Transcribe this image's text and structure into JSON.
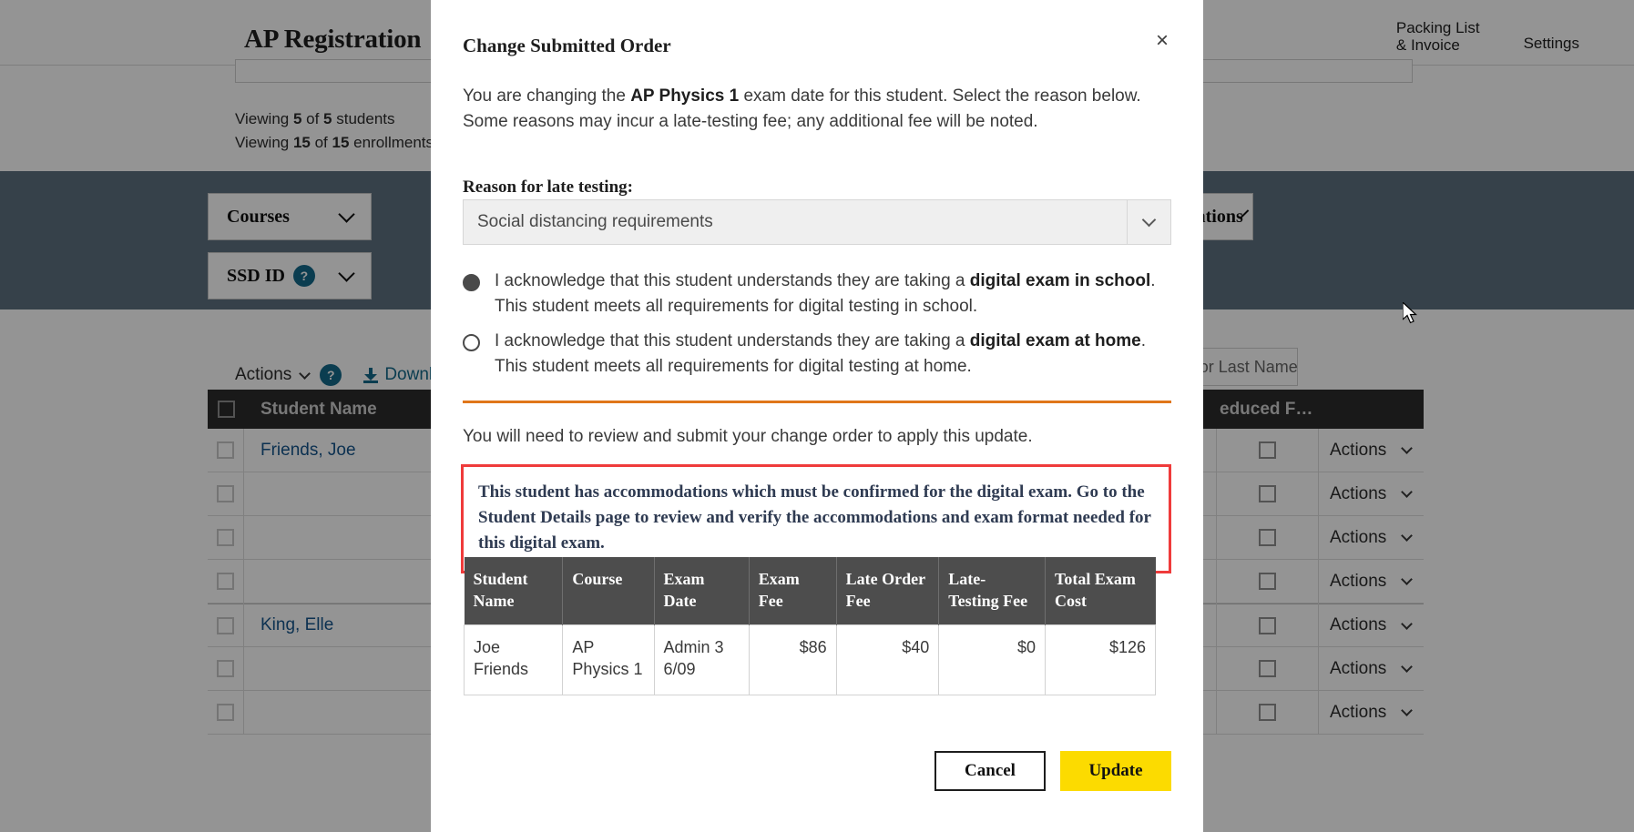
{
  "background": {
    "title": "AP Registration",
    "nav": [
      {
        "name": "packing-list-invoice",
        "line1": "Packing List",
        "line2": "& Invoice"
      },
      {
        "name": "settings",
        "line1": "Settings",
        "line2": ""
      }
    ],
    "viewing_students": "Viewing 5 of 5 students",
    "viewing_students_parts": {
      "prefix": "Viewing ",
      "count": "5",
      "mid": " of ",
      "total": "5",
      "suffix": " students"
    },
    "viewing_enrollments_parts": {
      "prefix": "Viewing ",
      "count": "15",
      "mid": " of ",
      "total": "15",
      "suffix": " enrollments"
    },
    "filters": [
      {
        "label": "Courses",
        "has_help": false
      },
      {
        "label": "SSD ID",
        "has_help": true
      },
      {
        "label": "Accommodations",
        "has_help": false
      }
    ],
    "actions_label": "Actions",
    "download_label": "Download",
    "search_placeholder": "Search by AP ID or Last Name",
    "table": {
      "headers": {
        "student_name": "Student Name",
        "reduced_fee": "educed F…",
        "actions": ""
      },
      "rows": [
        {
          "student": "Friends, Joe",
          "actions": "Actions",
          "group_start": true
        },
        {
          "student": "",
          "actions": "Actions",
          "group_start": false
        },
        {
          "student": "",
          "actions": "Actions",
          "group_start": false
        },
        {
          "student": "",
          "actions": "Actions",
          "group_start": false
        },
        {
          "student": "King, Elle",
          "actions": "Actions",
          "group_start": true
        },
        {
          "student": "",
          "actions": "Actions",
          "group_start": false
        },
        {
          "student": "",
          "actions": "Actions",
          "group_start": false
        }
      ]
    },
    "accent_filterbar": "#5d7080"
  },
  "modal": {
    "title": "Change Submitted Order",
    "close_label": "×",
    "intro": {
      "part1": "You are changing the ",
      "course": "AP Physics 1",
      "part2": " exam date for this student. Select the reason below. Some reasons may incur a late-testing fee; any additional fee will be noted."
    },
    "reason_label": "Reason for late testing:",
    "reason_selected": "Social distancing requirements",
    "radios": [
      {
        "name": "digital-exam-in-school",
        "checked": true,
        "part1": "I acknowledge that this student understands they are taking a ",
        "emphasis": "digital exam in school",
        "part2": ". This student meets all requirements for digital testing in school."
      },
      {
        "name": "digital-exam-at-home",
        "checked": false,
        "part1": "I acknowledge that this student understands they are taking a ",
        "emphasis": "digital exam at home",
        "part2": ". This student meets all requirements for digital testing at home."
      }
    ],
    "divider_color": "#e0761a",
    "note": "You will need to review and submit your change order to apply this update.",
    "alert": {
      "border_color": "#ef3b3b",
      "text": "This student has accommodations which must be confirmed for the digital exam. Go to the Student Details page to review and verify the accommodations and exam format needed for this digital exam."
    },
    "fee_table": {
      "headers": [
        "Student Name",
        "Course",
        "Exam Date",
        "Exam Fee",
        "Late Order Fee",
        "Late-Testing Fee",
        "Total Exam Cost"
      ],
      "rows": [
        {
          "student_name": "Joe Friends",
          "course": "AP Physics 1",
          "exam_date": "Admin 3 6/09",
          "exam_fee": "$86",
          "late_order_fee": "$40",
          "late_testing_fee": "$0",
          "total_exam_cost": "$126"
        }
      ]
    },
    "buttons": {
      "cancel": "Cancel",
      "update": "Update",
      "update_color": "#fcdb00"
    }
  }
}
